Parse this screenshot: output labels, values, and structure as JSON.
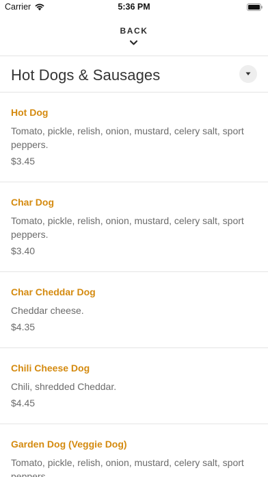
{
  "status_bar": {
    "carrier": "Carrier",
    "time": "5:36 PM",
    "wifi_icon": "wifi-icon",
    "battery_icon": "battery-icon"
  },
  "nav": {
    "back_label": "BACK",
    "back_icon": "chevron-down-icon"
  },
  "category": {
    "title": "Hot Dogs & Sausages",
    "dropdown_icon": "caret-down-icon"
  },
  "menu_items": [
    {
      "name": "Hot Dog",
      "description": "Tomato, pickle, relish, onion, mustard, celery salt, sport peppers.",
      "price": "$3.45"
    },
    {
      "name": "Char Dog",
      "description": "Tomato, pickle, relish, onion, mustard, celery salt, sport peppers.",
      "price": "$3.40"
    },
    {
      "name": "Char Cheddar Dog",
      "description": "Cheddar cheese.",
      "price": "$4.35"
    },
    {
      "name": "Chili Cheese Dog",
      "description": "Chili, shredded Cheddar.",
      "price": "$4.45"
    },
    {
      "name": "Garden Dog (Veggie Dog)",
      "description": "Tomato, pickle, relish, onion, mustard, celery salt, sport peppers.",
      "price": ""
    }
  ],
  "colors": {
    "item_name": "#d48a0f",
    "description": "#6b6b6b",
    "divider": "#e4e4e4"
  }
}
